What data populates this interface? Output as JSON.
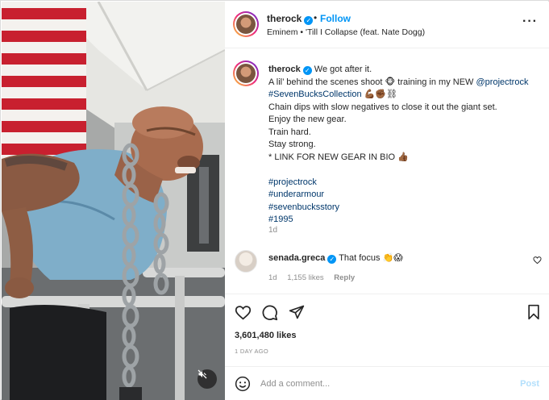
{
  "post": {
    "username": "therock",
    "follow_label": "Follow",
    "header_separator": "•",
    "audio": "Eminem • 'Till I Collapse (feat. Nate Dogg)"
  },
  "caption": {
    "username": "therock",
    "lines": [
      " We got after it.",
      "A lil’ behind the scenes shoot 🐵 training in my NEW ",
      "#SevenBucksCollection",
      " 💪🏾✊🏾⛓",
      "Chain dips with slow negatives to close it out the giant set.",
      "Enjoy the new gear.",
      "Train hard.",
      "Stay strong.",
      "* LINK FOR NEW GEAR IN BIO 👍🏾"
    ],
    "mention": "@projectrock",
    "hashtags": [
      "#projectrock",
      "#underarmour",
      "#sevenbucksstory",
      "#1995"
    ],
    "time": "1d"
  },
  "comment": {
    "username": "senada.greca",
    "text": "That focus 👏😱",
    "time": "1d",
    "likes": "1,155 likes",
    "reply_label": "Reply"
  },
  "actions": {
    "likes_count": "3,601,480 likes",
    "posted_ago": "1 DAY AGO"
  },
  "add_comment": {
    "placeholder": "Add a comment...",
    "post_label": "Post"
  },
  "colors": {
    "accent_blue": "#0095f6",
    "link_blue": "#00376b",
    "muted_gray": "#8e8e8e",
    "post_disabled": "#b2dffc"
  },
  "icons": [
    "more-options-icon",
    "verified-badge-icon",
    "heart-icon",
    "comment-icon",
    "share-icon",
    "bookmark-icon",
    "emoji-icon",
    "muted-audio-icon"
  ]
}
